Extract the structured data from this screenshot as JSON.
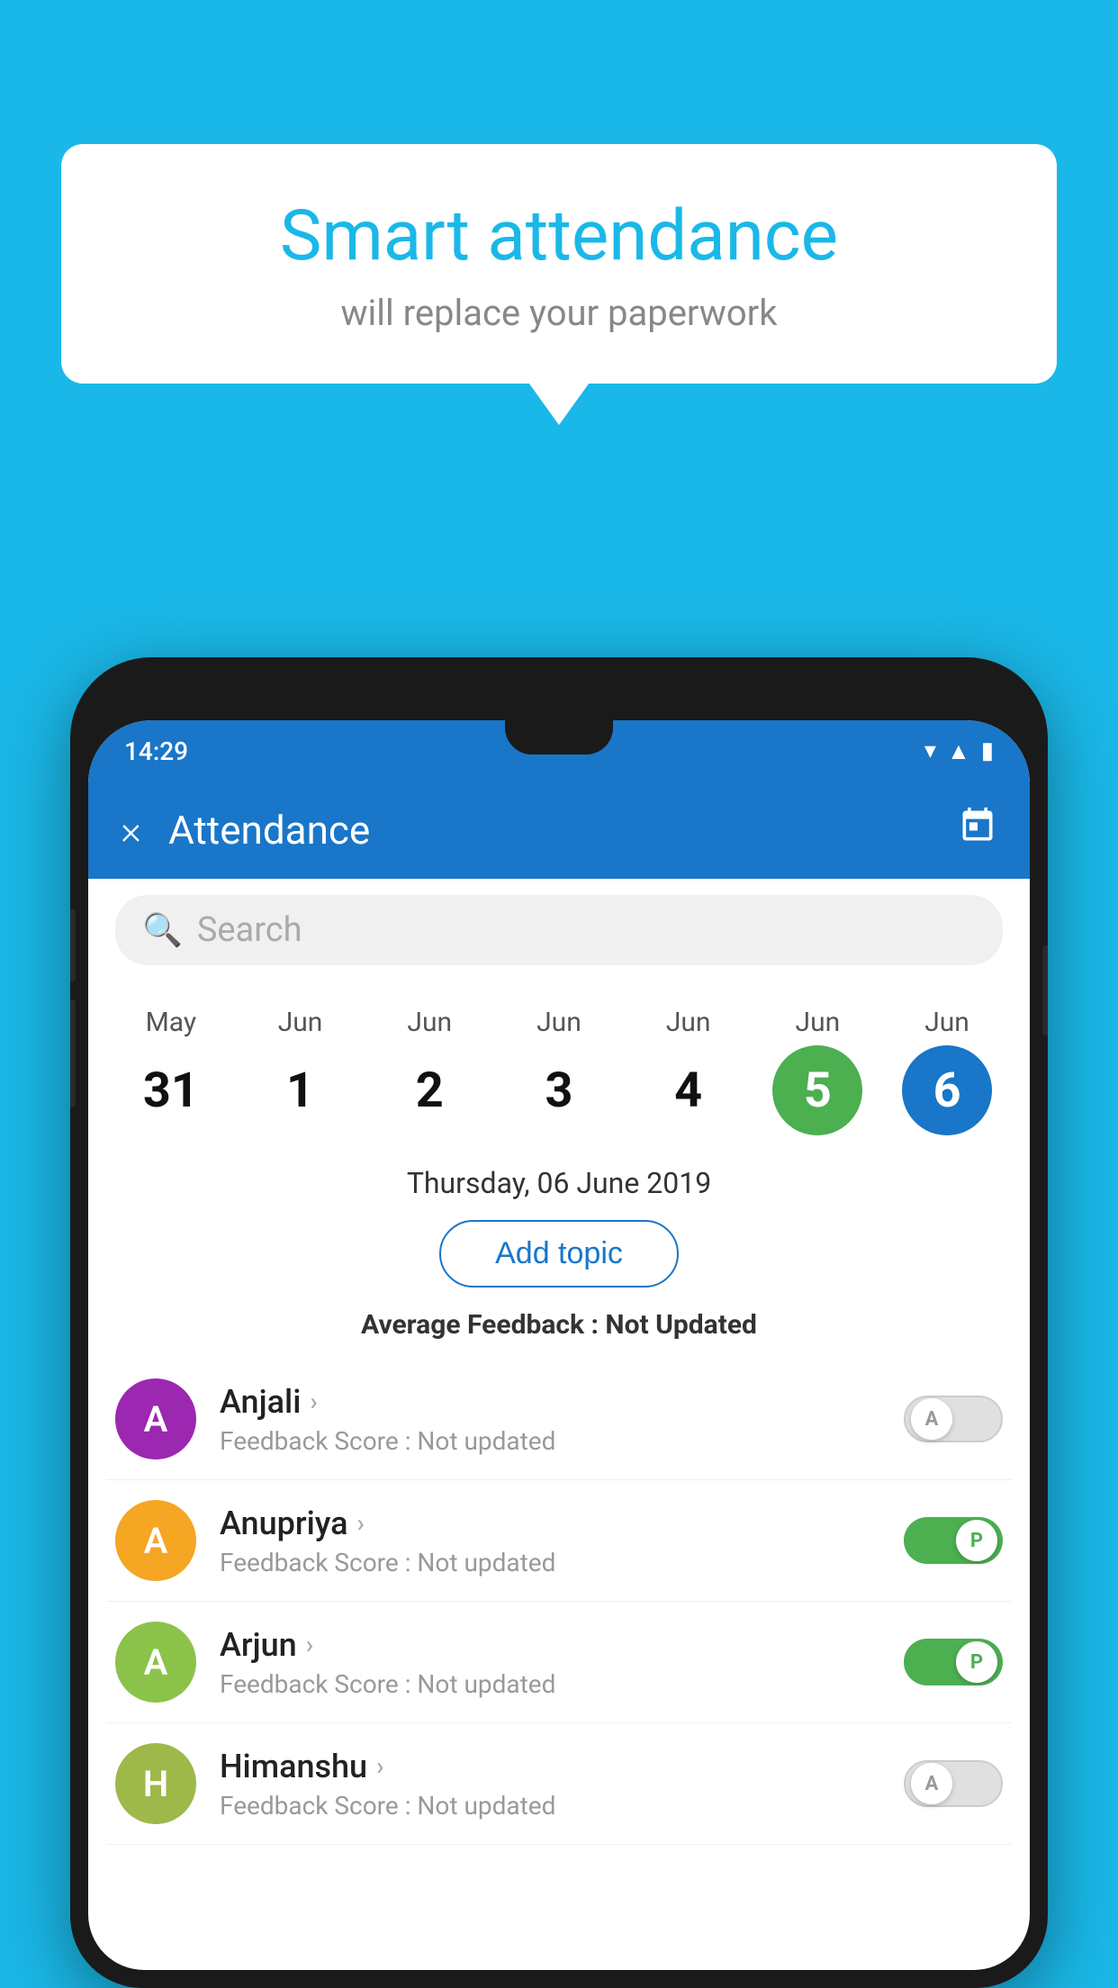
{
  "background_color": "#1ab8e8",
  "bubble": {
    "title": "Smart attendance",
    "subtitle": "will replace your paperwork"
  },
  "phone": {
    "status_bar": {
      "time": "14:29",
      "icons": [
        "wifi",
        "signal",
        "battery"
      ]
    },
    "app_bar": {
      "title": "Attendance",
      "close_label": "×",
      "calendar_icon": "📅"
    },
    "search": {
      "placeholder": "Search"
    },
    "dates": [
      {
        "month": "May",
        "day": "31",
        "state": "normal"
      },
      {
        "month": "Jun",
        "day": "1",
        "state": "normal"
      },
      {
        "month": "Jun",
        "day": "2",
        "state": "normal"
      },
      {
        "month": "Jun",
        "day": "3",
        "state": "normal"
      },
      {
        "month": "Jun",
        "day": "4",
        "state": "normal"
      },
      {
        "month": "Jun",
        "day": "5",
        "state": "today"
      },
      {
        "month": "Jun",
        "day": "6",
        "state": "selected"
      }
    ],
    "selected_date_label": "Thursday, 06 June 2019",
    "add_topic_label": "Add topic",
    "avg_feedback_label": "Average Feedback :",
    "avg_feedback_value": "Not Updated",
    "students": [
      {
        "name": "Anjali",
        "avatar_letter": "A",
        "avatar_color": "#9c27b0",
        "feedback": "Feedback Score : Not updated",
        "toggle_state": "off",
        "toggle_letter": "A"
      },
      {
        "name": "Anupriya",
        "avatar_letter": "A",
        "avatar_color": "#f5a623",
        "feedback": "Feedback Score : Not updated",
        "toggle_state": "on",
        "toggle_letter": "P"
      },
      {
        "name": "Arjun",
        "avatar_letter": "A",
        "avatar_color": "#8bc34a",
        "feedback": "Feedback Score : Not updated",
        "toggle_state": "on",
        "toggle_letter": "P"
      },
      {
        "name": "Himanshu",
        "avatar_letter": "H",
        "avatar_color": "#aab84a",
        "feedback": "Feedback Score : Not updated",
        "toggle_state": "off",
        "toggle_letter": "A"
      }
    ]
  }
}
